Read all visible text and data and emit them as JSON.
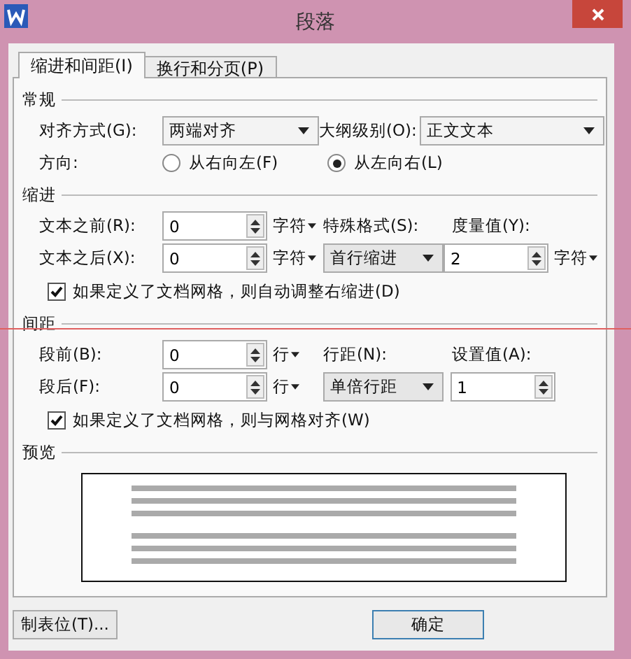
{
  "window": {
    "title": "段落"
  },
  "tabs": [
    {
      "label": "缩进和间距(I)",
      "selected": true
    },
    {
      "label": "换行和分页(P)",
      "selected": false
    }
  ],
  "general": {
    "heading": "常规",
    "alignment": {
      "label": "对齐方式(G):",
      "value": "两端对齐"
    },
    "outline_level": {
      "label": "大纲级别(O):",
      "value": "正文文本"
    },
    "direction": {
      "label": "方向:",
      "options": [
        {
          "label": "从右向左(F)",
          "selected": false
        },
        {
          "label": "从左向右(L)",
          "selected": true
        }
      ]
    }
  },
  "indent": {
    "heading": "缩进",
    "before": {
      "label": "文本之前(R):",
      "value": "0",
      "unit": "字符"
    },
    "after": {
      "label": "文本之后(X):",
      "value": "0",
      "unit": "字符"
    },
    "special": {
      "label": "特殊格式(S):",
      "value": "首行缩进"
    },
    "measure": {
      "label": "度量值(Y):",
      "value": "2",
      "unit": "字符"
    },
    "auto_adjust": {
      "label": "如果定义了文档网格，则自动调整右缩进(D)",
      "checked": true
    }
  },
  "spacing": {
    "heading": "间距",
    "before": {
      "label": "段前(B):",
      "value": "0",
      "unit": "行"
    },
    "after": {
      "label": "段后(F):",
      "value": "0",
      "unit": "行"
    },
    "line_spacing": {
      "label": "行距(N):",
      "value": "单倍行距"
    },
    "setting": {
      "label": "设置值(A):",
      "value": "1"
    },
    "snap": {
      "label": "如果定义了文档网格，则与网格对齐(W)",
      "checked": true
    }
  },
  "preview": {
    "heading": "预览"
  },
  "buttons": [
    {
      "label": "制表位(T)..."
    },
    {
      "label": "确定"
    }
  ]
}
